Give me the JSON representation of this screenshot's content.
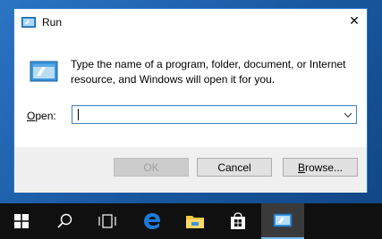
{
  "dialog": {
    "title": "Run",
    "description": "Type the name of a program, folder, document, or Internet resource, and Windows will open it for you.",
    "open_label_prefix": "",
    "open_label_underlined": "O",
    "open_label_rest": "pen:",
    "open_value": "",
    "ok_label": "OK",
    "cancel_label": "Cancel",
    "browse_label_underlined": "B",
    "browse_label_rest": "rowse...",
    "close_glyph": "✕"
  },
  "taskbar": {
    "items": [
      {
        "icon": "windows-start-icon"
      },
      {
        "icon": "search-icon"
      },
      {
        "icon": "task-view-icon"
      },
      {
        "icon": "edge-browser-icon"
      },
      {
        "icon": "file-explorer-icon"
      },
      {
        "icon": "store-icon"
      },
      {
        "icon": "run-app-icon",
        "active": true
      }
    ]
  },
  "colors": {
    "accent": "#2b78d0",
    "taskbar": "#101010",
    "active_underline": "#76b9ed",
    "edge_blue": "#1b7ad6",
    "folder_yellow": "#f4c542"
  }
}
